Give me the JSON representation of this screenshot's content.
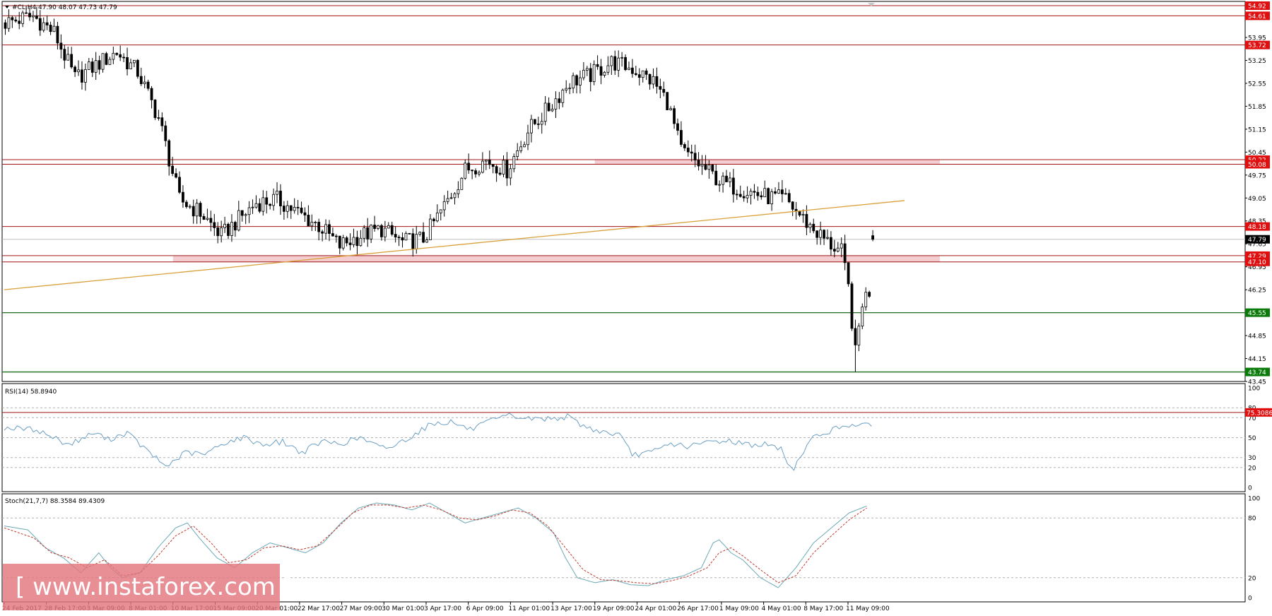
{
  "header": {
    "symbol_line": "#CL,H4  47.90 48.07 47.73 47.79"
  },
  "watermark": "[ www.instaforex.com ]",
  "colors": {
    "candle": "#000000",
    "resistance_line": "#a01414",
    "support_line": "#1a6a1a",
    "zone_fill": "#f2c4c9",
    "trendline": "#d9a03a",
    "rsi_line": "#6b9fc4",
    "stoch_main": "#6aa9b6",
    "stoch_signal": "#c0392b",
    "label_red": "#e01010",
    "label_green": "#0a7a0a",
    "label_current": "#000000"
  },
  "chart_data": [
    {
      "type": "candlestick",
      "panel": "price",
      "symbol": "#CL",
      "timeframe": "H4",
      "ohlc_last": {
        "open": 47.9,
        "high": 48.07,
        "low": 47.73,
        "close": 47.79
      },
      "ylim": [
        43.45,
        55.05
      ],
      "y_ticks": [
        "54.92",
        "54.61",
        "53.95",
        "53.72",
        "53.25",
        "52.55",
        "51.85",
        "51.15",
        "50.45",
        "50.22",
        "50.08",
        "49.75",
        "49.05",
        "48.35",
        "48.18",
        "47.65",
        "47.29",
        "47.10",
        "46.95",
        "46.25",
        "45.55",
        "44.85",
        "44.15",
        "43.74",
        "43.45"
      ],
      "x_labels": [
        "24 Feb 2017",
        "28 Feb 17:00",
        "3 Mar 09:00",
        "8 Mar 01:00",
        "10 Mar 17:00",
        "15 Mar 09:00",
        "20 Mar 01:00",
        "22 Mar 17:00",
        "27 Mar 09:00",
        "30 Mar 01:00",
        "3 Apr 17:00",
        "6 Apr 09:00",
        "11 Apr 01:00",
        "13 Apr 17:00",
        "19 Apr 09:00",
        "24 Apr 01:00",
        "26 Apr 17:00",
        "1 May 09:00",
        "4 May 01:00",
        "8 May 17:00",
        "11 May 09:00"
      ],
      "bar_count": 250,
      "close_anchors": [
        [
          0,
          54.4
        ],
        [
          8,
          54.6
        ],
        [
          14,
          54.1
        ],
        [
          20,
          52.7
        ],
        [
          26,
          53.1
        ],
        [
          32,
          53.5
        ],
        [
          38,
          52.9
        ],
        [
          44,
          51.5
        ],
        [
          50,
          49.0
        ],
        [
          56,
          48.6
        ],
        [
          62,
          47.9
        ],
        [
          66,
          48.3
        ],
        [
          72,
          48.9
        ],
        [
          78,
          49.0
        ],
        [
          84,
          48.6
        ],
        [
          90,
          48.2
        ],
        [
          96,
          47.6
        ],
        [
          102,
          47.9
        ],
        [
          108,
          48.1
        ],
        [
          114,
          47.7
        ],
        [
          120,
          47.8
        ],
        [
          126,
          48.8
        ],
        [
          132,
          49.9
        ],
        [
          138,
          50.2
        ],
        [
          144,
          49.9
        ],
        [
          150,
          51.1
        ],
        [
          156,
          51.8
        ],
        [
          162,
          52.6
        ],
        [
          168,
          52.8
        ],
        [
          174,
          53.2
        ],
        [
          180,
          53.0
        ],
        [
          186,
          52.6
        ],
        [
          190,
          52.0
        ],
        [
          194,
          50.5
        ],
        [
          200,
          50.0
        ],
        [
          206,
          49.5
        ],
        [
          212,
          49.3
        ],
        [
          218,
          49.1
        ],
        [
          224,
          49.0
        ],
        [
          230,
          48.3
        ],
        [
          236,
          47.7
        ],
        [
          240,
          47.4
        ],
        [
          242,
          46.3
        ],
        [
          244,
          44.3
        ],
        [
          246,
          45.9
        ],
        [
          250,
          46.5
        ]
      ],
      "horizontal_levels": [
        {
          "label": "54.92",
          "value": 54.92,
          "color": "red"
        },
        {
          "label": "54.61",
          "value": 54.61,
          "color": "red"
        },
        {
          "label": "53.72",
          "value": 53.72,
          "color": "red"
        },
        {
          "label": "50.22",
          "value": 50.22,
          "color": "red"
        },
        {
          "label": "50.08",
          "value": 50.08,
          "color": "red"
        },
        {
          "label": "48.18",
          "value": 48.18,
          "color": "red"
        },
        {
          "label": "47.29",
          "value": 47.29,
          "color": "red"
        },
        {
          "label": "47.10",
          "value": 47.1,
          "color": "red"
        },
        {
          "label": "45.55",
          "value": 45.55,
          "color": "green"
        },
        {
          "label": "43.74",
          "value": 43.74,
          "color": "green"
        }
      ],
      "current_price": {
        "label": "47.79",
        "value": 47.79
      },
      "zones": [
        {
          "from": 50.08,
          "to": 50.22,
          "start_date": "19 Apr 09:00"
        },
        {
          "from": 47.1,
          "to": 47.29,
          "start_date": "10 Mar 17:00"
        }
      ],
      "trendline": [
        {
          "date": "24 Feb 2017",
          "price": 46.25
        },
        {
          "date": "11 May 09:00",
          "price": 48.8
        }
      ]
    },
    {
      "type": "line",
      "panel": "rsi",
      "title": "RSI(14) 58.8940",
      "ylim": [
        0,
        100
      ],
      "y_ticks": [
        "100",
        "80",
        "70",
        "50",
        "30",
        "20",
        "0"
      ],
      "level_label": "75.3086",
      "level_value": 75.3086,
      "anchors": [
        [
          0,
          60
        ],
        [
          10,
          58
        ],
        [
          20,
          43
        ],
        [
          28,
          55
        ],
        [
          32,
          48
        ],
        [
          38,
          55
        ],
        [
          44,
          37
        ],
        [
          50,
          21
        ],
        [
          56,
          35
        ],
        [
          62,
          33
        ],
        [
          68,
          45
        ],
        [
          74,
          50
        ],
        [
          80,
          43
        ],
        [
          86,
          46
        ],
        [
          92,
          35
        ],
        [
          98,
          46
        ],
        [
          104,
          44
        ],
        [
          110,
          50
        ],
        [
          116,
          40
        ],
        [
          120,
          41
        ],
        [
          126,
          52
        ],
        [
          132,
          64
        ],
        [
          138,
          66
        ],
        [
          144,
          58
        ],
        [
          150,
          66
        ],
        [
          156,
          72
        ],
        [
          162,
          69
        ],
        [
          168,
          69
        ],
        [
          174,
          71
        ],
        [
          180,
          60
        ],
        [
          186,
          55
        ],
        [
          190,
          53
        ],
        [
          194,
          33
        ],
        [
          200,
          35
        ],
        [
          206,
          44
        ],
        [
          212,
          41
        ],
        [
          218,
          46
        ],
        [
          224,
          47
        ],
        [
          230,
          43
        ],
        [
          236,
          43
        ],
        [
          240,
          38
        ],
        [
          242,
          26
        ],
        [
          244,
          17
        ],
        [
          246,
          33
        ],
        [
          250,
          50
        ],
        [
          256,
          58
        ],
        [
          262,
          64
        ],
        [
          268,
          61
        ]
      ]
    },
    {
      "type": "line",
      "panel": "stochastic",
      "title": "Stoch(21,7,7) 88.3584 89.4309",
      "ylim": [
        0,
        100
      ],
      "y_ticks": [
        "100",
        "80",
        "20",
        "0"
      ],
      "series": [
        {
          "name": "main",
          "anchors": [
            [
              0,
              72
            ],
            [
              8,
              68
            ],
            [
              14,
              50
            ],
            [
              20,
              40
            ],
            [
              26,
              25
            ],
            [
              32,
              45
            ],
            [
              36,
              30
            ],
            [
              40,
              20
            ],
            [
              46,
              25
            ],
            [
              52,
              50
            ],
            [
              58,
              70
            ],
            [
              62,
              75
            ],
            [
              66,
              60
            ],
            [
              72,
              40
            ],
            [
              78,
              30
            ],
            [
              84,
              45
            ],
            [
              90,
              55
            ],
            [
              96,
              50
            ],
            [
              102,
              45
            ],
            [
              108,
              55
            ],
            [
              114,
              75
            ],
            [
              120,
              90
            ],
            [
              126,
              95
            ],
            [
              132,
              93
            ],
            [
              138,
              88
            ],
            [
              144,
              95
            ],
            [
              150,
              85
            ],
            [
              156,
              75
            ],
            [
              162,
              80
            ],
            [
              168,
              85
            ],
            [
              174,
              90
            ],
            [
              180,
              80
            ],
            [
              186,
              65
            ],
            [
              190,
              40
            ],
            [
              194,
              20
            ],
            [
              200,
              15
            ],
            [
              206,
              18
            ],
            [
              212,
              13
            ],
            [
              218,
              12
            ],
            [
              224,
              18
            ],
            [
              230,
              22
            ],
            [
              236,
              30
            ],
            [
              240,
              55
            ],
            [
              242,
              58
            ],
            [
              244,
              52
            ],
            [
              246,
              45
            ],
            [
              250,
              38
            ],
            [
              256,
              20
            ],
            [
              262,
              10
            ],
            [
              268,
              30
            ],
            [
              274,
              55
            ],
            [
              280,
              70
            ],
            [
              286,
              85
            ],
            [
              292,
              92
            ]
          ]
        },
        {
          "name": "signal",
          "anchors": [
            [
              0,
              70
            ],
            [
              10,
              60
            ],
            [
              16,
              45
            ],
            [
              22,
              40
            ],
            [
              28,
              30
            ],
            [
              34,
              38
            ],
            [
              40,
              22
            ],
            [
              46,
              25
            ],
            [
              52,
              42
            ],
            [
              58,
              62
            ],
            [
              64,
              72
            ],
            [
              70,
              55
            ],
            [
              76,
              35
            ],
            [
              82,
              38
            ],
            [
              88,
              50
            ],
            [
              94,
              52
            ],
            [
              100,
              48
            ],
            [
              106,
              52
            ],
            [
              112,
              68
            ],
            [
              118,
              85
            ],
            [
              124,
              93
            ],
            [
              130,
              93
            ],
            [
              136,
              90
            ],
            [
              142,
              93
            ],
            [
              148,
              88
            ],
            [
              154,
              80
            ],
            [
              160,
              78
            ],
            [
              166,
              82
            ],
            [
              172,
              88
            ],
            [
              178,
              85
            ],
            [
              184,
              72
            ],
            [
              190,
              50
            ],
            [
              196,
              28
            ],
            [
              202,
              18
            ],
            [
              208,
              17
            ],
            [
              214,
              15
            ],
            [
              220,
              14
            ],
            [
              226,
              17
            ],
            [
              232,
              22
            ],
            [
              238,
              30
            ],
            [
              242,
              45
            ],
            [
              246,
              50
            ],
            [
              250,
              42
            ],
            [
              256,
              28
            ],
            [
              262,
              15
            ],
            [
              268,
              22
            ],
            [
              274,
              45
            ],
            [
              280,
              62
            ],
            [
              286,
              78
            ],
            [
              292,
              90
            ]
          ]
        }
      ]
    }
  ]
}
